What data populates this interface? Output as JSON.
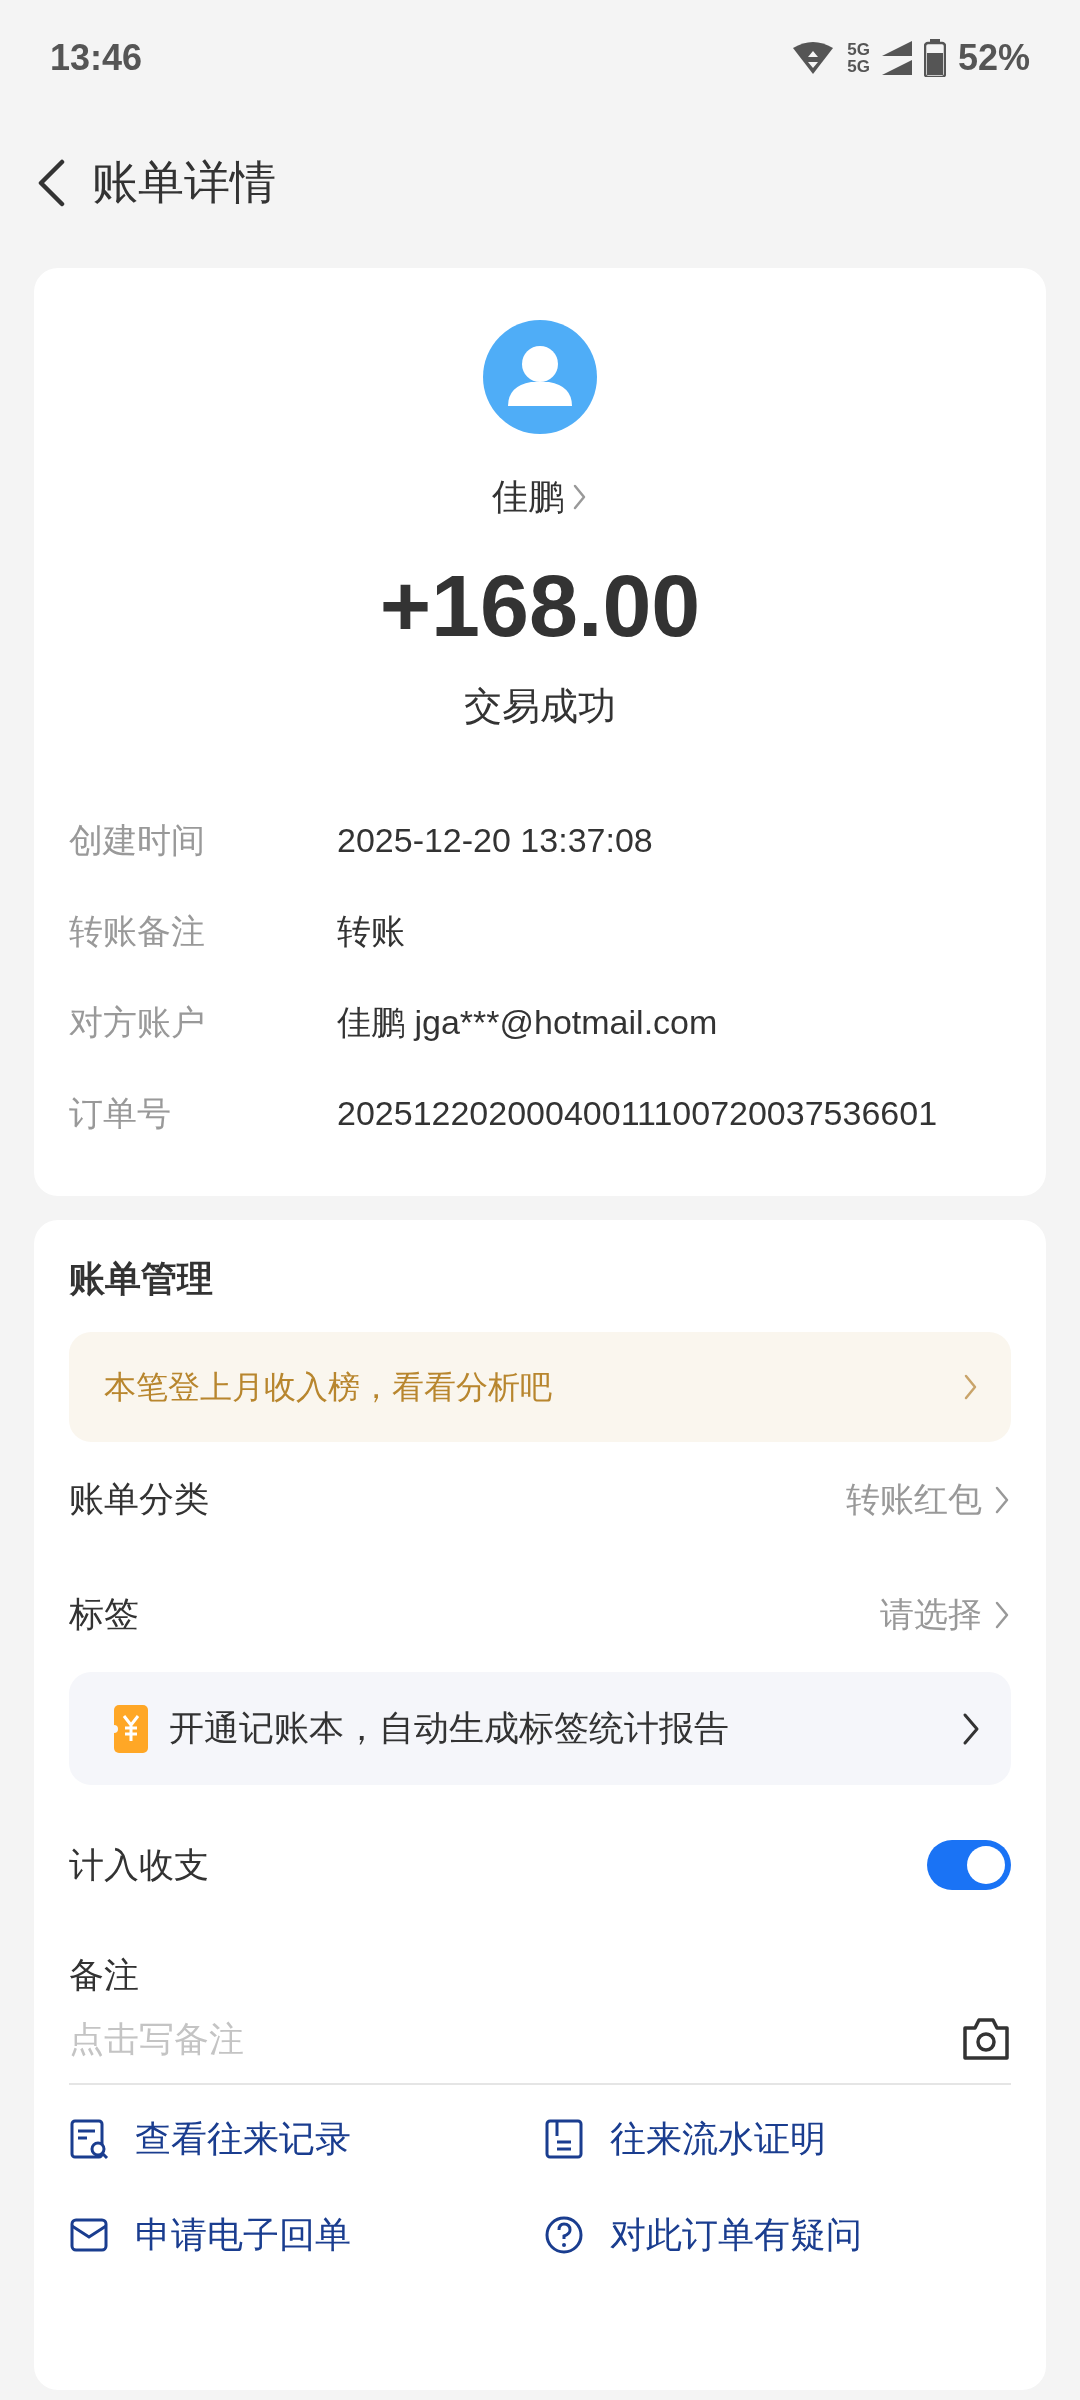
{
  "status_bar": {
    "time": "13:46",
    "network": [
      "5G",
      "5G"
    ],
    "battery": "52%"
  },
  "header": {
    "title": "账单详情"
  },
  "summary": {
    "name": "佳鹏",
    "amount": "+168.00",
    "status": "交易成功",
    "details": [
      {
        "label": "创建时间",
        "value": "2025-12-20 13:37:08"
      },
      {
        "label": "转账备注",
        "value": "转账"
      },
      {
        "label": "对方账户",
        "value": "佳鹏 jga***@hotmail.com"
      },
      {
        "label": "订单号",
        "value": "20251220200040011100720037536601"
      }
    ]
  },
  "management": {
    "title": "账单管理",
    "banner": {
      "text": "本笔登上月收入榜，看看分析吧"
    },
    "rows": [
      {
        "label": "账单分类",
        "value": "转账红包"
      },
      {
        "label": "标签",
        "value": "请选择"
      }
    ],
    "promo": {
      "text": "开通记账本，自动生成标签统计报告"
    },
    "toggle": {
      "label": "计入收支",
      "on": true
    },
    "note": {
      "label": "备注",
      "placeholder": "点击写备注"
    },
    "actions": [
      {
        "label": "查看往来记录"
      },
      {
        "label": "往来流水证明"
      },
      {
        "label": "申请电子回单"
      },
      {
        "label": "对此订单有疑问"
      }
    ]
  }
}
